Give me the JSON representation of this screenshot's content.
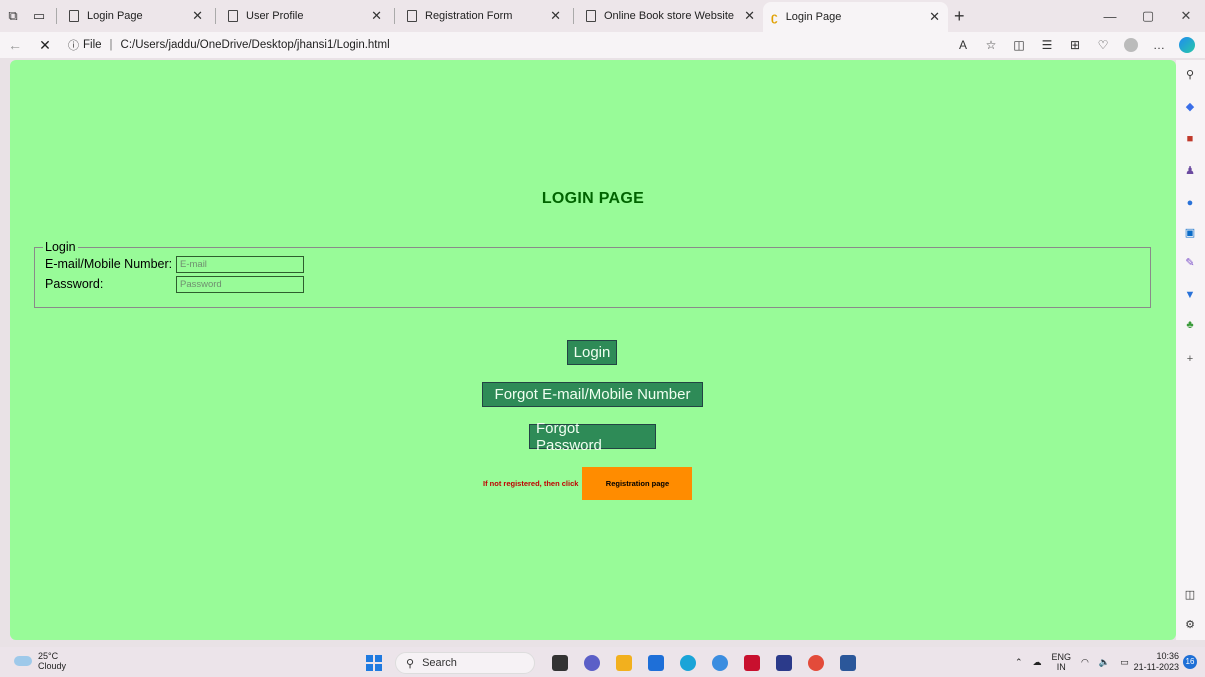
{
  "browser": {
    "tabs": [
      {
        "title": "Login Page",
        "active": false
      },
      {
        "title": "User Profile",
        "active": false
      },
      {
        "title": "Registration Form",
        "active": false
      },
      {
        "title": "Online Book store Website",
        "active": false
      },
      {
        "title": "Login Page",
        "active": true
      }
    ],
    "address": {
      "scheme_label": "File",
      "path": "C:/Users/jaddu/OneDrive/Desktop/jhansi1/Login.html"
    }
  },
  "page": {
    "heading": "LOGIN PAGE",
    "fieldset_legend": "Login",
    "email_label": "E-mail/Mobile Number:",
    "email_placeholder": "E-mail",
    "password_label": "Password:",
    "password_placeholder": "Password",
    "login_button": "Login",
    "forgot_email_button": "Forgot E-mail/Mobile Number",
    "forgot_password_button": "Forgot Password",
    "register_prompt": "If not registered, then click",
    "register_button": "Registration page",
    "background_color": "#98fb98",
    "button_color": "#2e8b57",
    "register_button_color": "#ff8c00"
  },
  "taskbar": {
    "weather_temp": "25°C",
    "weather_desc": "Cloudy",
    "search_label": "Search",
    "lang_top": "ENG",
    "lang_bottom": "IN",
    "time": "10:36",
    "date": "21-11-2023",
    "notification_count": "16"
  }
}
